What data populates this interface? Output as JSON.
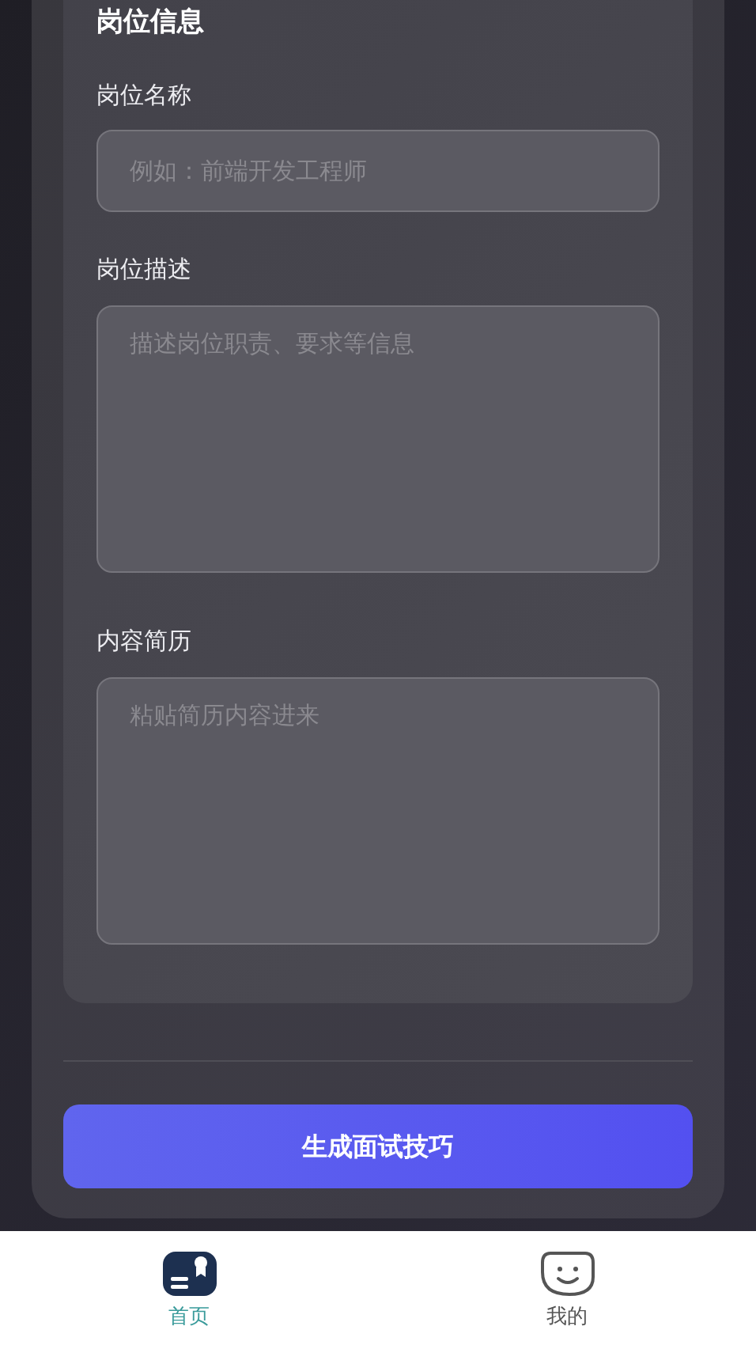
{
  "section_title": "岗位信息",
  "fields": [
    {
      "kind": "input",
      "label": "岗位名称",
      "placeholder": "例如：前端开发工程师"
    },
    {
      "kind": "textarea",
      "label": "岗位描述",
      "placeholder": "描述岗位职责、要求等信息"
    },
    {
      "kind": "textarea",
      "label": "内容简历",
      "placeholder": "粘贴简历内容进来"
    }
  ],
  "submit_button": "生成面试技巧",
  "tab_bar": [
    {
      "kind": "home",
      "label": "首页",
      "selected": true
    },
    {
      "kind": "profile",
      "label": "我的",
      "selected": false
    }
  ]
}
